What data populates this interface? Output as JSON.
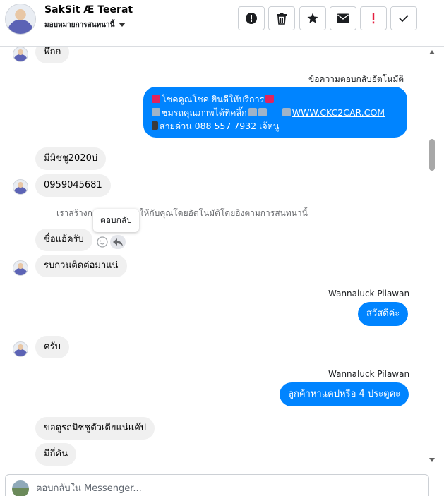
{
  "header": {
    "name": "SakSit Æ Teerat",
    "subtitle": "มอบหมายการสนทนานี้"
  },
  "toolbar": {
    "icons": [
      "alert-icon",
      "trash-icon",
      "star-icon",
      "envelope-icon",
      "red-exclamation-icon",
      "check-icon"
    ],
    "accent_red": "#e41e3f"
  },
  "messages": {
    "m1": "พึกก",
    "auto_label": "ข้อความตอบกลับอัตโนมัติ",
    "auto_line1": "โชคคูณโชค ยินดีให้บริการ",
    "auto_line2": "ชมรถคุณภาพได้ที่คลิ๊ก",
    "auto_link": "WWW.CKC2CAR.COM",
    "auto_line3": "สายด่วน 088 557 7932 เจ้หนู",
    "m2": "มีมิชชู2020บ่",
    "m3": "0959045681",
    "sys": "เราสร้างก           ค้าเป้าหมายให้กับคุณโดยอัตโนมัติโดยอิงตามการสนทนานี้",
    "tooltip": "ตอบกลับ",
    "m4": "ชื่อแอ้ครับ",
    "m5": "รบกวนติดต่อมาแน่",
    "sender1": "Wannaluck Pilawan",
    "out1": "สวัสดีค่ะ",
    "m6": "ครับ",
    "sender2": "Wannaluck Pilawan",
    "out2": "ลูกค้าหาแคปหรือ 4 ประตูคะ",
    "m7": "ขอดูรถมิชชูตัวเตียแน่แค๊ป",
    "m8": "มีกี่คัน"
  },
  "composer": {
    "placeholder": "ตอบกลับใน Messenger..."
  },
  "colors": {
    "outgoing": "#0084ff",
    "incoming": "#f0f0f0"
  }
}
